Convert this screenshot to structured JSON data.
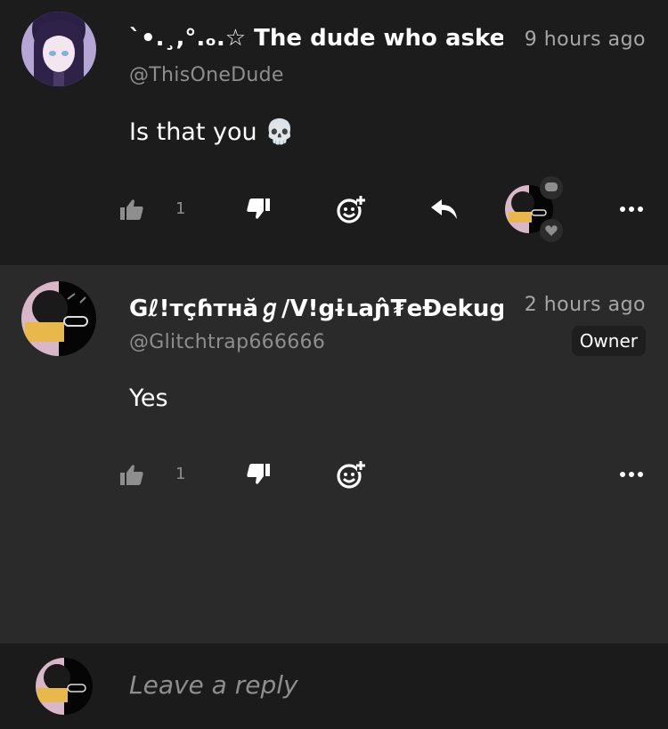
{
  "comments": [
    {
      "username": "`•.¸,°.ₒ.☆ The dude who asked",
      "handle": "@ThisOneDude",
      "time": "9 hours ago",
      "text": "Is that you 💀",
      "likes": "1",
      "has_replies": true
    },
    {
      "username": "Gℓ!тçɦтʜăℊ/V!ցɨʟаɲ̂₮eĐekuց",
      "handle": "@Glitchtrap666666",
      "time": "2 hours ago",
      "badge": "Owner",
      "text": "Yes",
      "likes": "1",
      "has_replies": false
    }
  ],
  "reply_box": {
    "placeholder": "Leave a reply"
  },
  "colors": {
    "background": "#1b1b1b",
    "highlighted_comment": "#2a2a2a",
    "muted_text": "#8e8e8e"
  },
  "icons": [
    "thumbs-up-icon",
    "thumbs-down-icon",
    "add-emoji-icon",
    "reply-icon",
    "more-icon",
    "comment-icon",
    "heart-icon"
  ]
}
